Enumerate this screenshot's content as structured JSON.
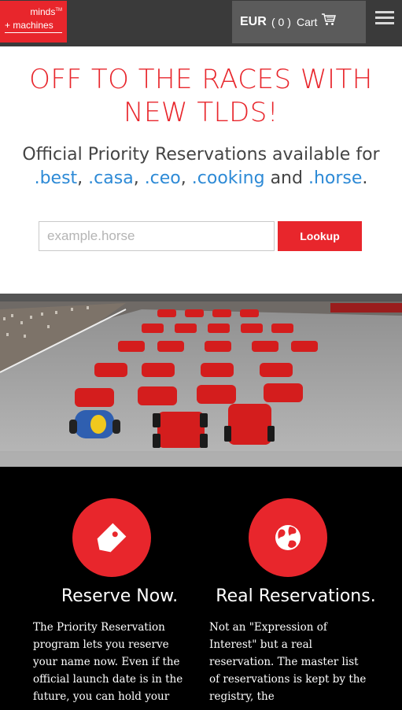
{
  "header": {
    "logo_line1": "minds",
    "logo_tm": "TM",
    "logo_line2": "+ machines",
    "currency": "EUR",
    "cart_count": "( 0 )",
    "cart_label": "Cart",
    "cart_icon": "cart-icon",
    "menu_icon": "hamburger-menu-icon"
  },
  "hero": {
    "headline_line1": "OFF TO THE RACES WITH",
    "headline_line2": "NEW TLDS!",
    "sub_text": "Official Priority Reservations available for",
    "tlds": [
      ".best",
      ".casa",
      ".ceo",
      ".cooking",
      ".horse"
    ],
    "sep_comma": ",",
    "sep_and": "and",
    "end_period": "."
  },
  "search": {
    "placeholder": "example.horse",
    "button_label": "Lookup"
  },
  "features": [
    {
      "icon": "tag-icon",
      "title": "Reserve Now.",
      "text": "The Priority Reservation program lets you reserve your name now. Even if the official launch date is in the future, you can hold your"
    },
    {
      "icon": "globe-icon",
      "title": "Real Reservations.",
      "text": "Not an \"Expression of Interest\" but a real reservation. The master list of reservations is kept by the registry, the"
    }
  ],
  "colors": {
    "brand_red": "#e8262c",
    "link_blue": "#2d8ad6",
    "header_dark": "#3a3a3a"
  }
}
